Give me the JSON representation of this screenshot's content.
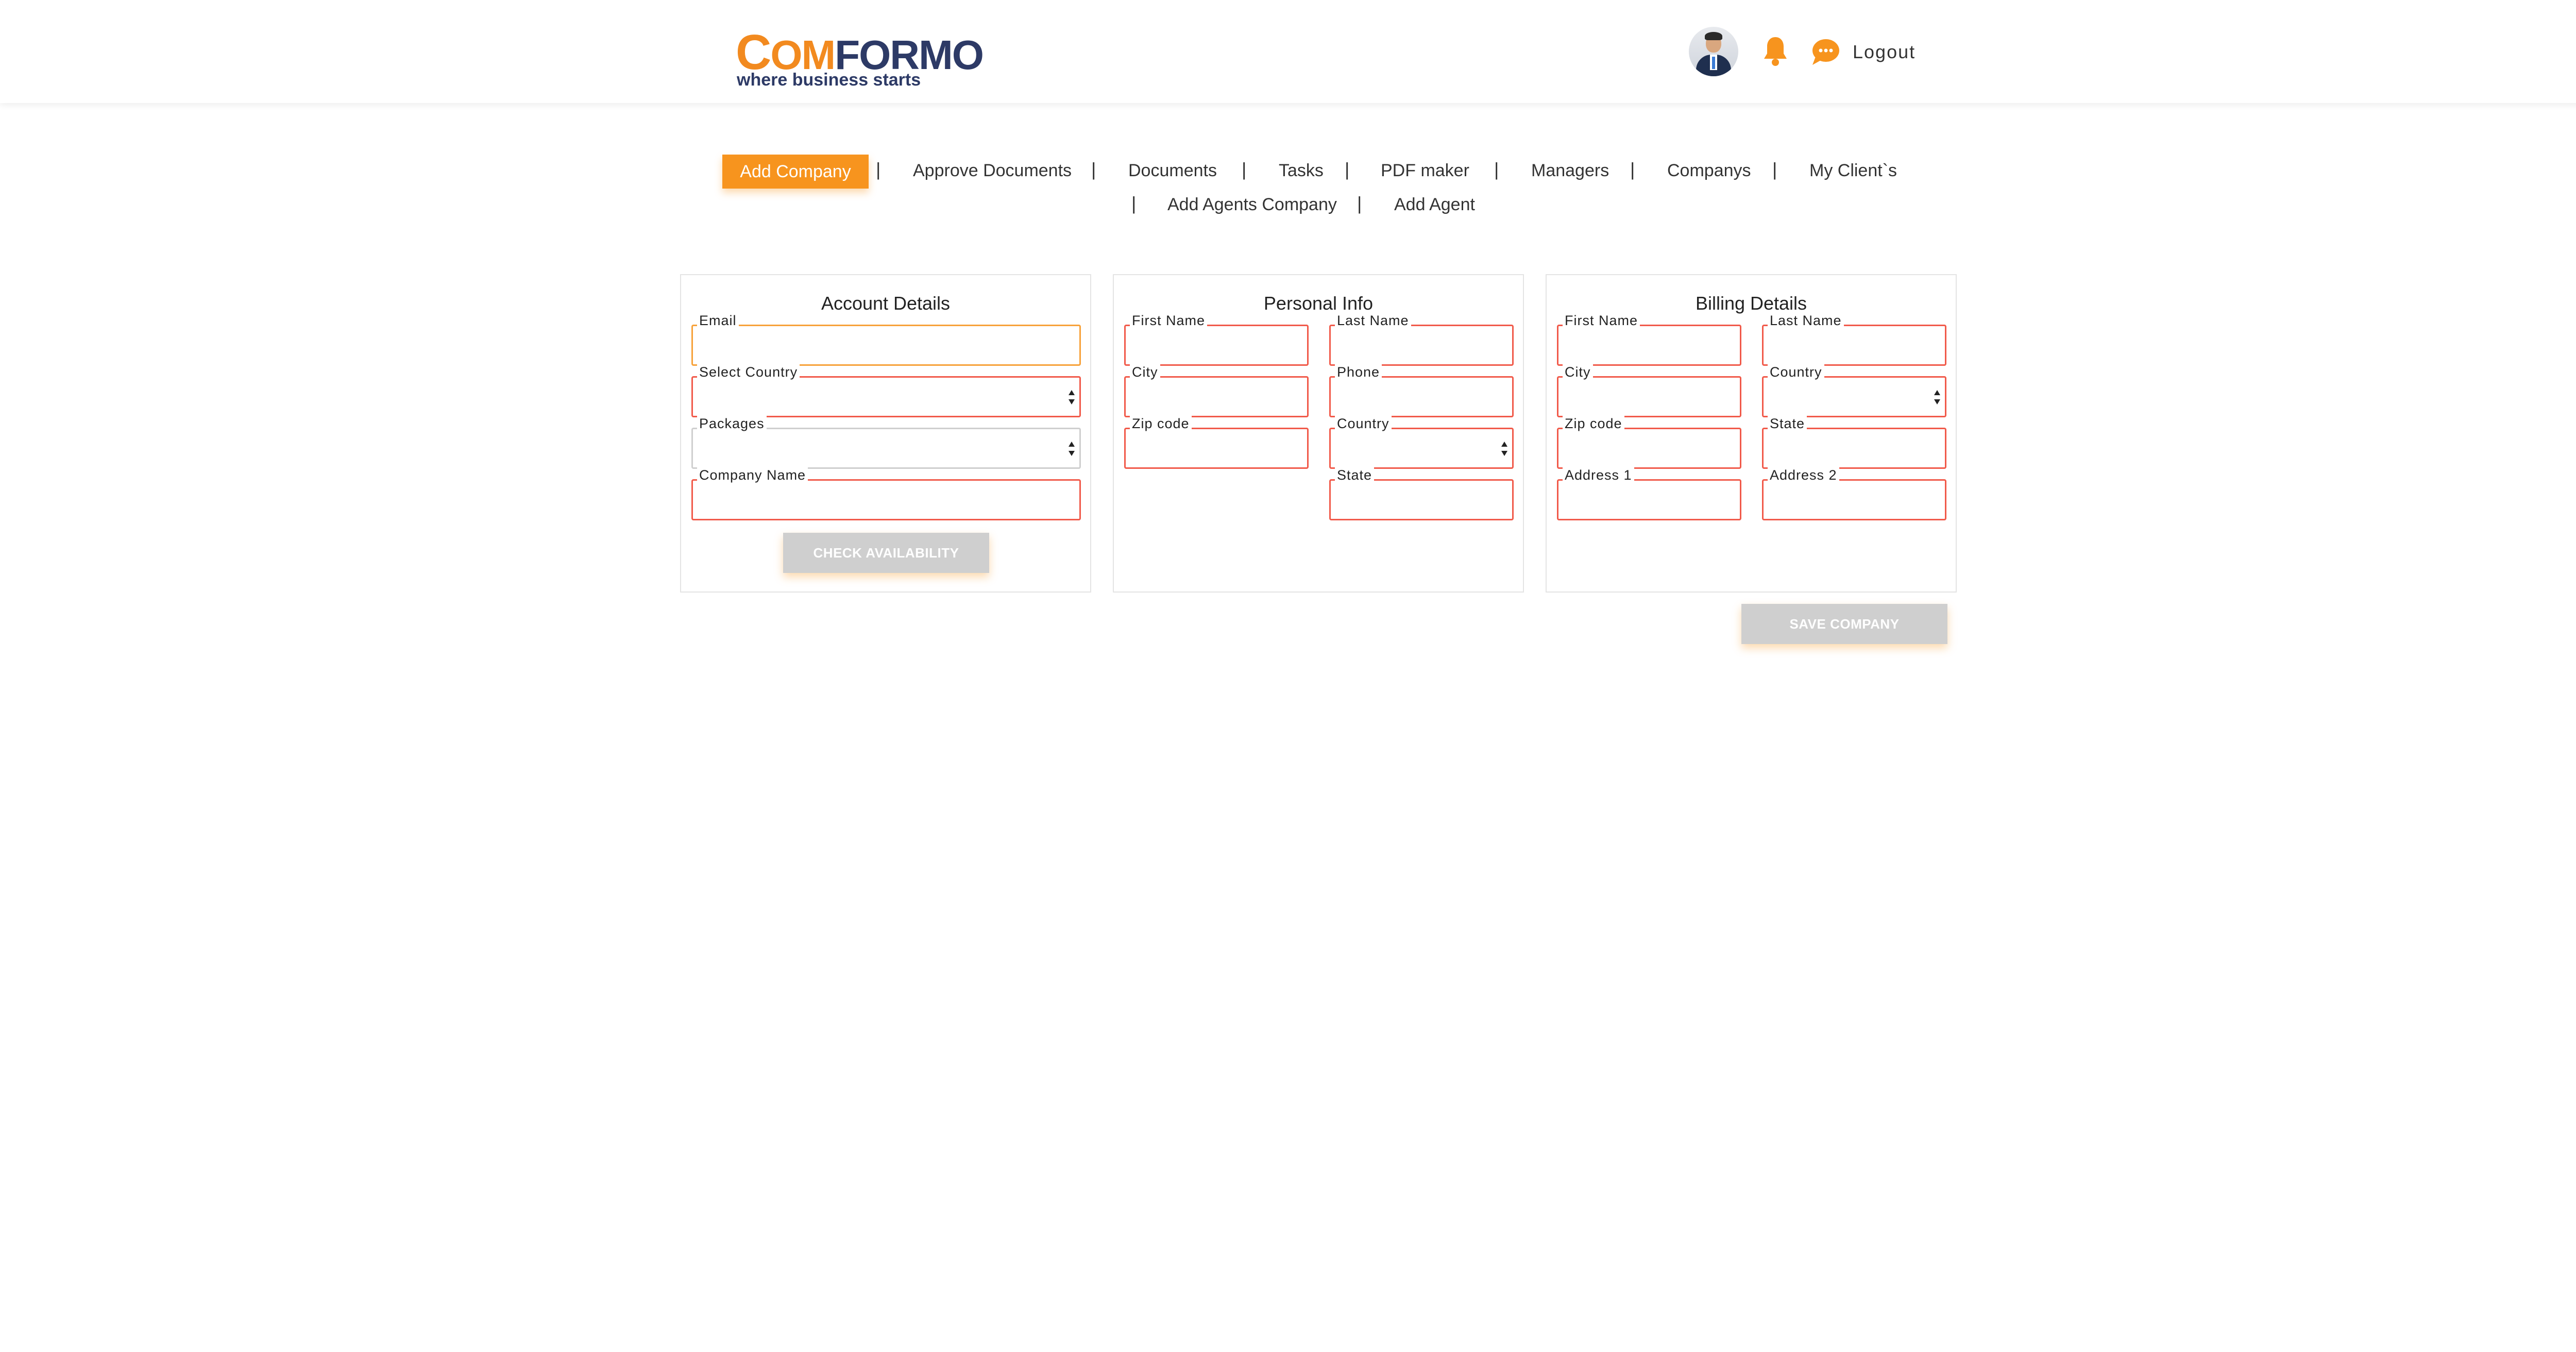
{
  "header": {
    "logo": {
      "c": "C",
      "om": "OM",
      "formo": "FORMO",
      "tagline": "where business starts"
    },
    "avatar_icon": "user-avatar",
    "bell_icon": "bell-icon",
    "chat_icon": "chat-icon",
    "logout_label": "Logout"
  },
  "nav": {
    "active": "Add Company",
    "items": [
      "Approve Documents",
      "Documents",
      "Tasks",
      "PDF maker",
      "Managers",
      "Companys",
      "My Client`s",
      "Add Agents Company",
      "Add Agent"
    ],
    "separator": "|"
  },
  "account": {
    "title": "Account Details",
    "email_label": "Email",
    "country_label": "Select Country",
    "packages_label": "Packages",
    "company_label": "Company Name",
    "check_button": "CHECK AVAILABILITY"
  },
  "personal": {
    "title": "Personal Info",
    "first_name_label": "First Name",
    "last_name_label": "Last Name",
    "city_label": "City",
    "phone_label": "Phone",
    "zip_label": "Zip code",
    "country_label": "Country",
    "state_label": "State"
  },
  "billing": {
    "title": "Billing Details",
    "first_name_label": "First Name",
    "last_name_label": "Last Name",
    "city_label": "City",
    "country_label": "Country",
    "zip_label": "Zip code",
    "state_label": "State",
    "address1_label": "Address 1",
    "address2_label": "Address 2"
  },
  "save_button": "SAVE COMPANY",
  "colors": {
    "accent": "#f7941e",
    "field_border": "#f15a4a",
    "brand_navy": "#2d3a66",
    "button_disabled": "#cfcfcf"
  }
}
